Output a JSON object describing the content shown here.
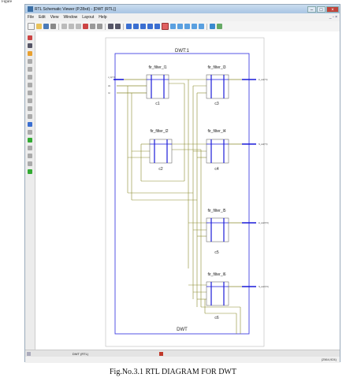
{
  "page_label": "Figure",
  "window": {
    "title": "RTL Schematic Viewer (P.28xd) - [DWT (RTL)]",
    "menu": [
      "File",
      "Edit",
      "View",
      "Window",
      "Layout",
      "Help"
    ]
  },
  "schematic": {
    "top_instance_label": "DWT:1",
    "module_label": "DWT",
    "instances": [
      {
        "type": "fir_filter_l1",
        "inst": "c1"
      },
      {
        "type": "fir_filter_l3",
        "inst": "c3"
      },
      {
        "type": "fir_filter_l2",
        "inst": "c2"
      },
      {
        "type": "fir_filter_l4",
        "inst": "c4"
      },
      {
        "type": "fir_filter_l5",
        "inst": "c5"
      },
      {
        "type": "fir_filter_l6",
        "inst": "c6"
      }
    ]
  },
  "tab": {
    "label": "DWT (RTL)"
  },
  "status": {
    "coords": "(2564,924)"
  },
  "caption": "Fig.No.3.1 RTL DIAGRAM FOR DWT",
  "colors": {
    "wire": "#8a8a2e",
    "bus": "#1a1ad8",
    "border": "#2b2be0"
  }
}
